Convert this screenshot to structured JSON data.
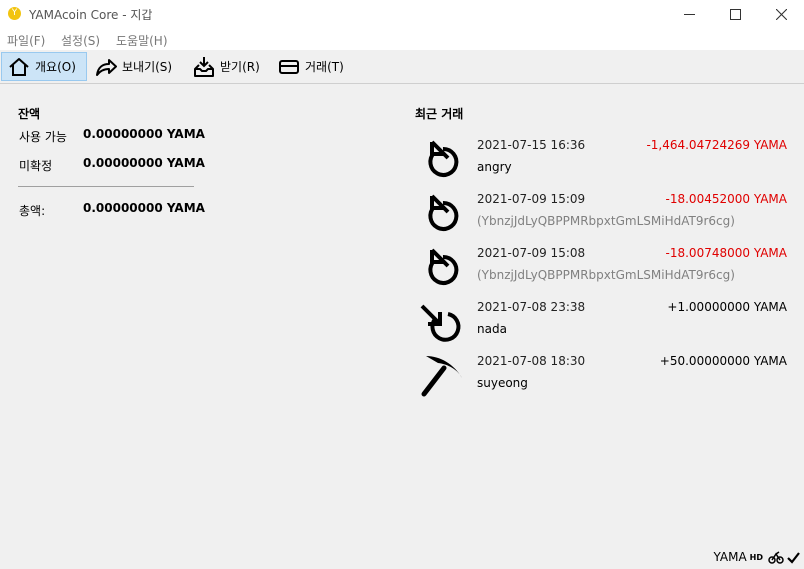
{
  "window": {
    "title": "YAMAcoin Core - 지갑",
    "app_icon_letter": "Y"
  },
  "menu": [
    "파일(F)",
    "설정(S)",
    "도움말(H)"
  ],
  "toolbar": {
    "overview": "개요(O)",
    "send": "보내기(S)",
    "receive": "받기(R)",
    "transactions": "거래(T)"
  },
  "balances": {
    "title": "잔액",
    "available_label": "사용 가능",
    "available_value": "0.00000000 YAMA",
    "pending_label": "미확정",
    "pending_value": "0.00000000 YAMA",
    "total_label": "총액:",
    "total_value": "0.00000000 YAMA"
  },
  "recent": {
    "title": "최근 거래",
    "transactions": [
      {
        "icon": "send-icon",
        "date": "2021-07-15 16:36",
        "amount": "-1,464.04724269 YAMA",
        "label": "angry",
        "negative": true,
        "label_muted": false
      },
      {
        "icon": "send-icon",
        "date": "2021-07-09 15:09",
        "amount": "-18.00452000 YAMA",
        "label": "(YbnzjJdLyQBPPMRbpxtGmLSMiHdAT9r6cg)",
        "negative": true,
        "label_muted": true
      },
      {
        "icon": "send-icon",
        "date": "2021-07-09 15:08",
        "amount": "-18.00748000 YAMA",
        "label": "(YbnzjJdLyQBPPMRbpxtGmLSMiHdAT9r6cg)",
        "negative": true,
        "label_muted": true
      },
      {
        "icon": "receive-icon",
        "date": "2021-07-08 23:38",
        "amount": "+1.00000000 YAMA",
        "label": "nada",
        "negative": false,
        "label_muted": false
      },
      {
        "icon": "pickaxe-icon",
        "date": "2021-07-08 18:30",
        "amount": "+50.00000000 YAMA",
        "label": "suyeong",
        "negative": false,
        "label_muted": false
      }
    ]
  },
  "status": {
    "unit": "YAMA",
    "hd": "HD"
  },
  "colors": {
    "negative": "#e00000",
    "active_tab": "#cce4f7",
    "app_icon": "#f2c40f"
  }
}
